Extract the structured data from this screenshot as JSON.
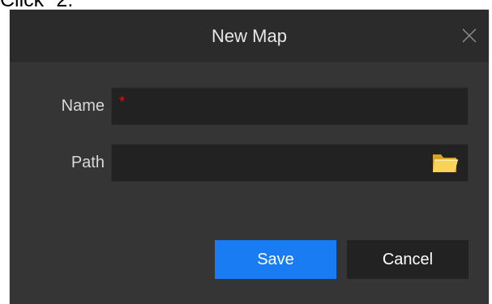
{
  "context": {
    "text": "Click ”2."
  },
  "dialog": {
    "title": "New Map",
    "name_label": "Name",
    "path_label": "Path",
    "name_required_marker": "*",
    "name_value": "",
    "path_value": "",
    "save_label": "Save",
    "cancel_label": "Cancel",
    "close_icon": "close-icon",
    "folder_icon": "folder-icon"
  },
  "colors": {
    "dialog_background": "#353535",
    "titlebar_background": "#2b2b2b",
    "field_background": "#222222",
    "primary_button": "#1a7cf2",
    "required_marker": "#e01313"
  }
}
